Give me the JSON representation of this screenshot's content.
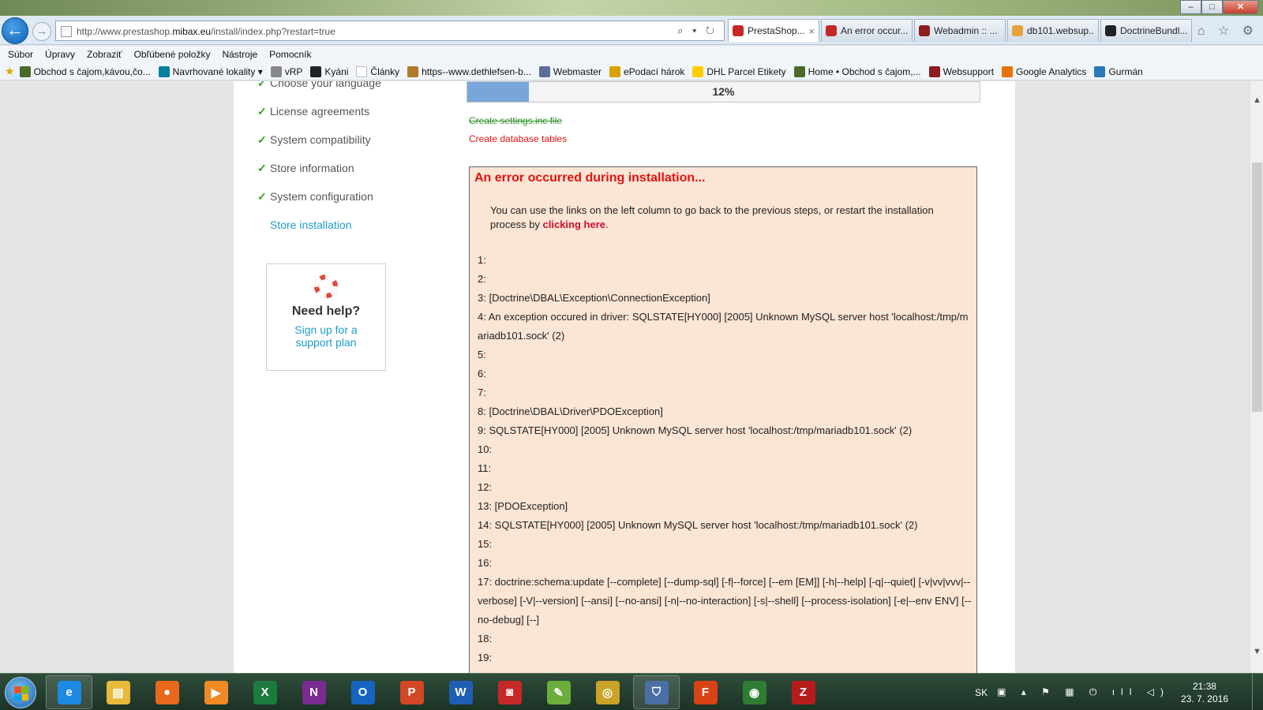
{
  "browser": {
    "url_prefix": "http://www.prestashop.",
    "url_domain": "mibax.eu",
    "url_suffix": "/install/index.php?restart=true",
    "address_tools": "⌕ ▾ ↻",
    "tabs": [
      {
        "label": "PrestaShop...",
        "color": "#c62828",
        "active": true
      },
      {
        "label": "An error occur...",
        "color": "#c62828",
        "active": false
      },
      {
        "label": "Webadmin :: ...",
        "color": "#8b1e1e",
        "active": false
      },
      {
        "label": "db101.websup...",
        "color": "#e6a23c",
        "active": false
      },
      {
        "label": "DoctrineBundl...",
        "color": "#222222",
        "active": false
      }
    ],
    "tab_close": "×",
    "nav_right_icons": "⌂ ☆ ⚙",
    "window_buttons": {
      "minimize": "–",
      "maximize": "□",
      "close": "✕"
    }
  },
  "menu": [
    "Súbor",
    "Úpravy",
    "Zobraziť",
    "Obľúbené položky",
    "Nástroje",
    "Pomocník"
  ],
  "favorites": [
    {
      "label": "Obchod s čajom,kávou,čo...",
      "color": "#4a6a2a"
    },
    {
      "label": "Navrhované lokality ▾",
      "color": "#00809d"
    },
    {
      "label": "vRP",
      "color": "#888888"
    },
    {
      "label": "Kyáni",
      "color": "#222222"
    },
    {
      "label": "Články",
      "color": "#ffffff"
    },
    {
      "label": "https--www.dethlefsen-b...",
      "color": "#b07a2a"
    },
    {
      "label": "Webmaster",
      "color": "#5b6e9a"
    },
    {
      "label": "ePodací hárok",
      "color": "#d9a200"
    },
    {
      "label": "DHL Parcel Etikety",
      "color": "#ffcc00"
    },
    {
      "label": "Home • Obchod s čajom,...",
      "color": "#4a6a2a"
    },
    {
      "label": "Websupport",
      "color": "#8b1e1e"
    },
    {
      "label": "Google Analytics",
      "color": "#e8710a"
    },
    {
      "label": "Gurmán",
      "color": "#2a7ab8"
    }
  ],
  "steps": [
    {
      "label": "Choose your language",
      "done": true
    },
    {
      "label": "License agreements",
      "done": true
    },
    {
      "label": "System compatibility",
      "done": true
    },
    {
      "label": "Store information",
      "done": true
    },
    {
      "label": "System configuration",
      "done": true
    },
    {
      "label": "Store installation",
      "done": false
    }
  ],
  "check_glyph": "✓",
  "help": {
    "title": "Need help?",
    "link_line1": "Sign up for a",
    "link_line2": "support plan"
  },
  "progress": {
    "value": 0.12,
    "label": "12%"
  },
  "install_steps": {
    "done": "Create settings.inc file",
    "failed": "Create database tables"
  },
  "error": {
    "title": "An error occurred during installation...",
    "message_before": "You can use the links on the left column to go back to the previous steps, or restart the installation process by ",
    "message_link": "clicking here",
    "message_after": ".",
    "log": [
      "1:",
      "2:",
      "3: [Doctrine\\DBAL\\Exception\\ConnectionException]",
      "4: An exception occured in driver: SQLSTATE[HY000] [2005] Unknown MySQL server host 'localhost:/tmp/mariadb101.sock' (2)",
      "5:",
      "6:",
      "7:",
      "8: [Doctrine\\DBAL\\Driver\\PDOException]",
      "9: SQLSTATE[HY000] [2005] Unknown MySQL server host 'localhost:/tmp/mariadb101.sock' (2)",
      "10:",
      "11:",
      "12:",
      "13: [PDOException]",
      "14: SQLSTATE[HY000] [2005] Unknown MySQL server host 'localhost:/tmp/mariadb101.sock' (2)",
      "15:",
      "16:",
      "17: doctrine:schema:update [--complete] [--dump-sql] [-f|--force] [--em [EM]] [-h|--help] [-q|--quiet] [-v|vv|vvv|--verbose] [-V|--version] [--ansi] [--no-ansi] [-n|--no-interaction] [-s|--shell] [--process-isolation] [-e|--env ENV] [--no-debug] [--]",
      "18:",
      "19:"
    ]
  },
  "scrollbar": {
    "up": "▲",
    "down": "▼"
  },
  "taskbar": {
    "apps": [
      {
        "name": "internet-explorer",
        "glyph": "e",
        "color": "#1e88e5",
        "pinned": true
      },
      {
        "name": "file-explorer",
        "glyph": "▤",
        "color": "#e8b93a",
        "pinned": false
      },
      {
        "name": "firefox",
        "glyph": "●",
        "color": "#e8691e",
        "pinned": false
      },
      {
        "name": "media-player",
        "glyph": "▶",
        "color": "#f08a24",
        "pinned": false
      },
      {
        "name": "excel",
        "glyph": "X",
        "color": "#1d7a3f",
        "pinned": false
      },
      {
        "name": "onenote",
        "glyph": "N",
        "color": "#7a2b8f",
        "pinned": false
      },
      {
        "name": "outlook",
        "glyph": "O",
        "color": "#1565c0",
        "pinned": false
      },
      {
        "name": "powerpoint",
        "glyph": "P",
        "color": "#d24726",
        "pinned": false
      },
      {
        "name": "word",
        "glyph": "W",
        "color": "#1e5fb4",
        "pinned": false
      },
      {
        "name": "camera-app",
        "glyph": "◙",
        "color": "#c62828",
        "pinned": false
      },
      {
        "name": "evernote",
        "glyph": "✎",
        "color": "#6cae3c",
        "pinned": false
      },
      {
        "name": "coins-app",
        "glyph": "◎",
        "color": "#c9a227",
        "pinned": false
      },
      {
        "name": "security-app",
        "glyph": "⛉",
        "color": "#4a6fa5",
        "pinned": true
      },
      {
        "name": "foxit-reader",
        "glyph": "F",
        "color": "#d84315",
        "pinned": false
      },
      {
        "name": "chrome",
        "glyph": "◉",
        "color": "#2e7d32",
        "pinned": false
      },
      {
        "name": "filezilla",
        "glyph": "Z",
        "color": "#b71c1c",
        "pinned": false
      }
    ],
    "language": "SK",
    "tray_icons": "▣ ▴ ⚑ ▦ ⏻ ıll ◁)",
    "time": "21:38",
    "date": "23. 7. 2016"
  }
}
